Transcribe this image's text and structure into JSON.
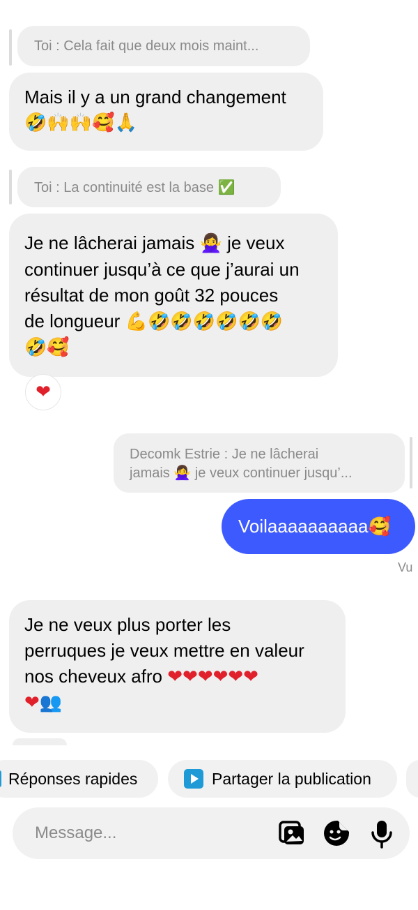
{
  "messages": {
    "m1_quote": "Toi : Cela fait que deux mois maint...",
    "m1_text_1": "Mais il y a un grand changement",
    "m1_emoji": "🤣🙌🙌🥰🙏",
    "m2_quote_text": "Toi : La continuité est la base",
    "m2_quote_emoji": "✅",
    "m2_l1_a": "Je ne lâcherai jamais",
    "m2_l1_emoji": "🙅‍♀️",
    "m2_l1_b": "je veux",
    "m2_l2": "continuer jusqu’à ce que j’aurai un",
    "m2_l3": "résultat de mon goût 32 pouces",
    "m2_l4_text": "de longueur",
    "m2_l4_emoji": "💪🤣🤣🤣🤣🤣🤣",
    "m2_l5_emoji": "🤣🥰",
    "m2_reaction": "❤",
    "m3_quote_l1": "Decomk Estrie : Je ne lâcherai",
    "m3_quote_l2_a": "jamais",
    "m3_quote_l2_emoji": "🙅‍♀️",
    "m3_quote_l2_b": "je veux continuer jusqu’...",
    "m3_text": "Voilaaaaaaaaaa",
    "m3_emoji": "🥰",
    "m3_status": "Vu",
    "m4_l1": "Je ne veux plus porter les",
    "m4_l2": "perruques je veux mettre en valeur",
    "m4_l3_text": "nos cheveux afro",
    "m4_l3_emoji": "❤❤❤❤❤❤",
    "m4_l4_emoji": "❤👥"
  },
  "quick_actions": {
    "quick_replies": "Réponses rapides",
    "share_post": "Partager la publication"
  },
  "composer": {
    "placeholder": "Message..."
  },
  "colors": {
    "outgoing_bubble": "#3d5afe",
    "incoming_bubble": "#efefef",
    "share_icon": "#1e9bd7"
  },
  "icons": [
    "gallery-icon",
    "sticker-icon",
    "microphone-icon",
    "play-icon"
  ]
}
